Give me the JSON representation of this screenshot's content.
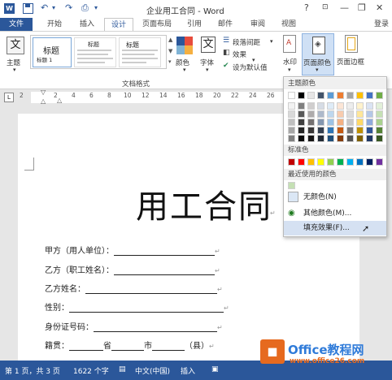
{
  "titlebar": {
    "title": "企业用工合同 - Word",
    "help": "?",
    "minimize": "—",
    "restore": "❐",
    "close": "✕",
    "logo_letter": "W"
  },
  "tabs": [
    {
      "label": "文件"
    },
    {
      "label": "开始"
    },
    {
      "label": "插入"
    },
    {
      "label": "设计"
    },
    {
      "label": "页面布局"
    },
    {
      "label": "引用"
    },
    {
      "label": "邮件"
    },
    {
      "label": "审阅"
    },
    {
      "label": "视图"
    }
  ],
  "login": "登录",
  "ribbon": {
    "theme_label": "主题",
    "theme_glyph": "文",
    "style_title_1": "标题",
    "style_sub_1": "标题 1",
    "style_title_2": "标题",
    "style_title_3": "标题",
    "group_doc_format": "文档格式",
    "colors_label": "颜色",
    "fonts_label": "字体",
    "fonts_glyph": "文",
    "paragraph_spacing": "段落间距",
    "effects": "效果",
    "set_default": "设为默认值",
    "watermark": "水印",
    "page_color": "页面颜色",
    "page_borders": "页面边框"
  },
  "ruler": {
    "corner": "L",
    "numbers": [
      "2",
      "2",
      "4",
      "6",
      "8",
      "10",
      "12",
      "14",
      "16",
      "18",
      "20",
      "22",
      "24",
      "26"
    ]
  },
  "document": {
    "heading": "用工合同",
    "fields": [
      "甲方（用人单位）：",
      "乙方（职工姓名）：",
      "乙方姓名：",
      "性别：",
      "身份证号码：",
      "籍贯："
    ],
    "birthplace_parts": [
      "省",
      "市",
      "（县）"
    ],
    "para_mark": "↵"
  },
  "dropdown": {
    "theme_colors_header": "主题颜色",
    "standard_colors_header": "标准色",
    "recent_colors_header": "最近使用的颜色",
    "no_color": "无颜色(N)",
    "more_colors": "其他颜色(M)...",
    "fill_effects": "填充效果(F)...",
    "theme_top_row": [
      "#ffffff",
      "#000000",
      "#e7e6e6",
      "#44546a",
      "#5b9bd5",
      "#ed7d31",
      "#a5a5a5",
      "#ffc000",
      "#4472c4",
      "#70ad47"
    ],
    "theme_columns": [
      [
        "#f2f2f2",
        "#d9d9d9",
        "#bfbfbf",
        "#a6a6a6",
        "#808080"
      ],
      [
        "#808080",
        "#595959",
        "#404040",
        "#262626",
        "#0d0d0d"
      ],
      [
        "#d0cece",
        "#aeabab",
        "#757171",
        "#3a3838",
        "#171616"
      ],
      [
        "#d6dce5",
        "#adb9ca",
        "#8497b0",
        "#333f50",
        "#222a35"
      ],
      [
        "#deebf7",
        "#bdd7ee",
        "#9dc3e6",
        "#2e75b6",
        "#1f4e79"
      ],
      [
        "#fbe5d6",
        "#f8cbad",
        "#f4b183",
        "#c55a11",
        "#843c0c"
      ],
      [
        "#ededed",
        "#dbdbdb",
        "#c9c9c9",
        "#7b7b7b",
        "#525252"
      ],
      [
        "#fff2cc",
        "#ffe699",
        "#ffd966",
        "#bf9000",
        "#7f6000"
      ],
      [
        "#dae3f3",
        "#b4c7e7",
        "#8faadc",
        "#2f5597",
        "#203864"
      ],
      [
        "#e2f0d9",
        "#c5e0b4",
        "#a9d18e",
        "#548235",
        "#385723"
      ]
    ],
    "standard_colors": [
      "#c00000",
      "#ff0000",
      "#ffc000",
      "#ffff00",
      "#92d050",
      "#00b050",
      "#00b0f0",
      "#0070c0",
      "#002060",
      "#7030a0"
    ],
    "recent_colors": [
      "#c5e0b4"
    ]
  },
  "statusbar": {
    "page": "第 1 页，共 3 页",
    "words": "1622 个字",
    "language": "中文(中国)",
    "mode": "插入"
  },
  "watermark_logo": {
    "text": "Office教程网",
    "url": "www.office26.com"
  }
}
